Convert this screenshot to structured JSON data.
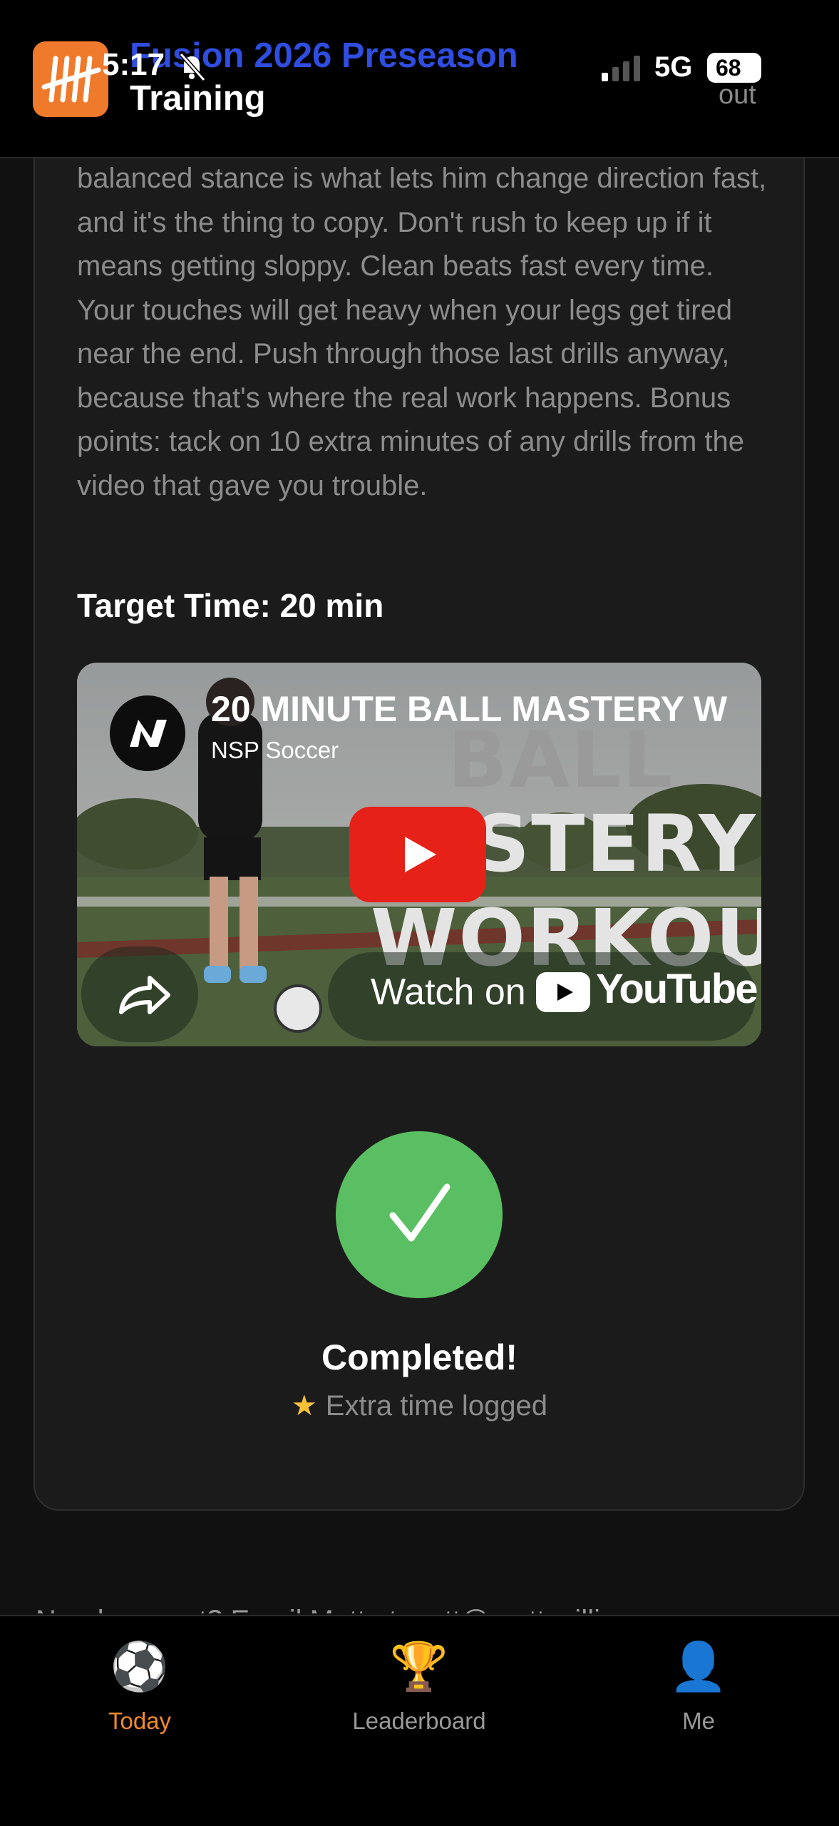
{
  "status_bar": {
    "time": "5:17",
    "network": "5G",
    "battery": "68"
  },
  "header": {
    "title_line1": "Fusion 2026 Preseason",
    "title_line2": "Training",
    "logout_label": "out"
  },
  "card": {
    "description": "balanced stance is what lets him change direction fast, and it's the thing to copy. Don't rush to keep up if it means getting sloppy. Clean beats fast every time. Your touches will get heavy when your legs get tired near the end. Push through those last drills anyway, because that's where the real work happens. Bonus points: tack on 10 extra minutes of any drills from the video that gave you trouble.",
    "target_time": "Target Time: 20 min",
    "video": {
      "title": "20 MINUTE BALL MASTERY W",
      "channel": "NSP Soccer",
      "overlay_line1": "BALL",
      "overlay_line2": "STERY",
      "overlay_line3": "WORKOUT",
      "watch_label": "Watch on",
      "brand": "YouTube"
    },
    "completed_label": "Completed!",
    "extra_time_label": "Extra time logged"
  },
  "footer_note": "Need support? Email Matt at matt@matt-williams",
  "tabs": [
    {
      "label": "Today",
      "icon": "soccer-ball-icon",
      "active": true
    },
    {
      "label": "Leaderboard",
      "icon": "trophy-icon",
      "active": false
    },
    {
      "label": "Me",
      "icon": "person-icon",
      "active": false
    }
  ],
  "colors": {
    "accent": "#f08a2c",
    "title_blue": "#2f4de0",
    "success_green": "#5abf62",
    "youtube_red": "#e62117"
  }
}
